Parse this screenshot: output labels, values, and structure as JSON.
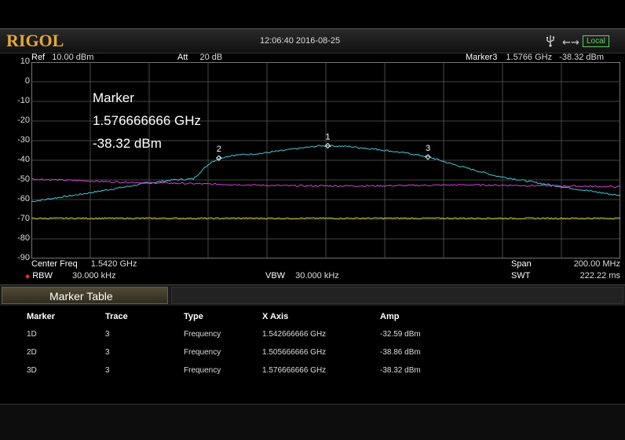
{
  "topbar": {
    "brand": "RIGOL",
    "datetime": "12:06:40 2016-08-25",
    "status": "Local"
  },
  "header": {
    "ref_label": "Ref",
    "ref_value": "10.00 dBm",
    "att_label": "Att",
    "att_value": "20 dB",
    "marker_label": "Marker3",
    "marker_freq": "1.5766 GHz",
    "marker_amp": "-38.32 dBm"
  },
  "y_axis_ticks": [
    "10",
    "0",
    "-10",
    "-20",
    "-30",
    "-40",
    "-50",
    "-60",
    "-70",
    "-80",
    "-90"
  ],
  "marker_readout": {
    "title": "Marker",
    "freq": "1.576666666 GHz",
    "amp": "-38.32 dBm"
  },
  "markers": [
    {
      "label": "1",
      "freq_ghz": 1.542666666,
      "amp_dbm": -32.59
    },
    {
      "label": "2",
      "freq_ghz": 1.505666666,
      "amp_dbm": -38.86
    },
    {
      "label": "3",
      "freq_ghz": 1.576666666,
      "amp_dbm": -38.32
    }
  ],
  "bottom": {
    "center_label": "Center Freq",
    "center_value": "1.5420 GHz",
    "rbw_label": "RBW",
    "rbw_value": "30.000 kHz",
    "vbw_label": "VBW",
    "vbw_value": "30.000 kHz",
    "span_label": "Span",
    "span_value": "200.00 MHz",
    "swt_label": "SWT",
    "swt_value": "222.22 ms"
  },
  "marker_table": {
    "title": "Marker Table",
    "headers": [
      "Marker",
      "Trace",
      "Type",
      "X Axis",
      "Amp"
    ],
    "rows": [
      [
        "1D",
        "3",
        "Frequency",
        "1.542666666 GHz",
        "-32.59 dBm"
      ],
      [
        "2D",
        "3",
        "Frequency",
        "1.505666666 GHz",
        "-38.86 dBm"
      ],
      [
        "3D",
        "3",
        "Frequency",
        "1.576666666 GHz",
        "-38.32 dBm"
      ]
    ]
  },
  "colors": {
    "trace_main": "#3ec8d8",
    "trace_magenta": "#d040d0",
    "trace_yellow": "#c8c832",
    "grid": "#5a5a5a",
    "brand": "#e4a83a"
  },
  "chart_data": {
    "type": "line",
    "xlim_ghz": [
      1.442,
      1.642
    ],
    "ylim": [
      -90,
      10
    ],
    "grid": true,
    "series": [
      {
        "x": [
          1.442,
          1.46,
          1.48,
          1.49,
          1.497,
          1.5,
          1.503,
          1.506,
          1.51,
          1.52,
          1.53,
          1.54,
          1.543,
          1.55,
          1.56,
          1.57,
          1.577,
          1.585,
          1.6,
          1.62,
          1.642
        ],
        "values": [
          -61,
          -57,
          -52,
          -50,
          -49.5,
          -45,
          -41,
          -38.9,
          -37.5,
          -36.5,
          -34.5,
          -32.6,
          -32.6,
          -33,
          -34.5,
          -36.5,
          -38.3,
          -42,
          -48,
          -53,
          -58
        ]
      },
      {
        "x": [
          1.442,
          1.47,
          1.5,
          1.53,
          1.56,
          1.59,
          1.62,
          1.642
        ],
        "values": [
          -49.5,
          -51,
          -52,
          -53,
          -53,
          -52.5,
          -53,
          -53.5
        ]
      },
      {
        "x": [
          1.442,
          1.642
        ],
        "values": [
          -69.5,
          -69.5
        ]
      }
    ]
  }
}
